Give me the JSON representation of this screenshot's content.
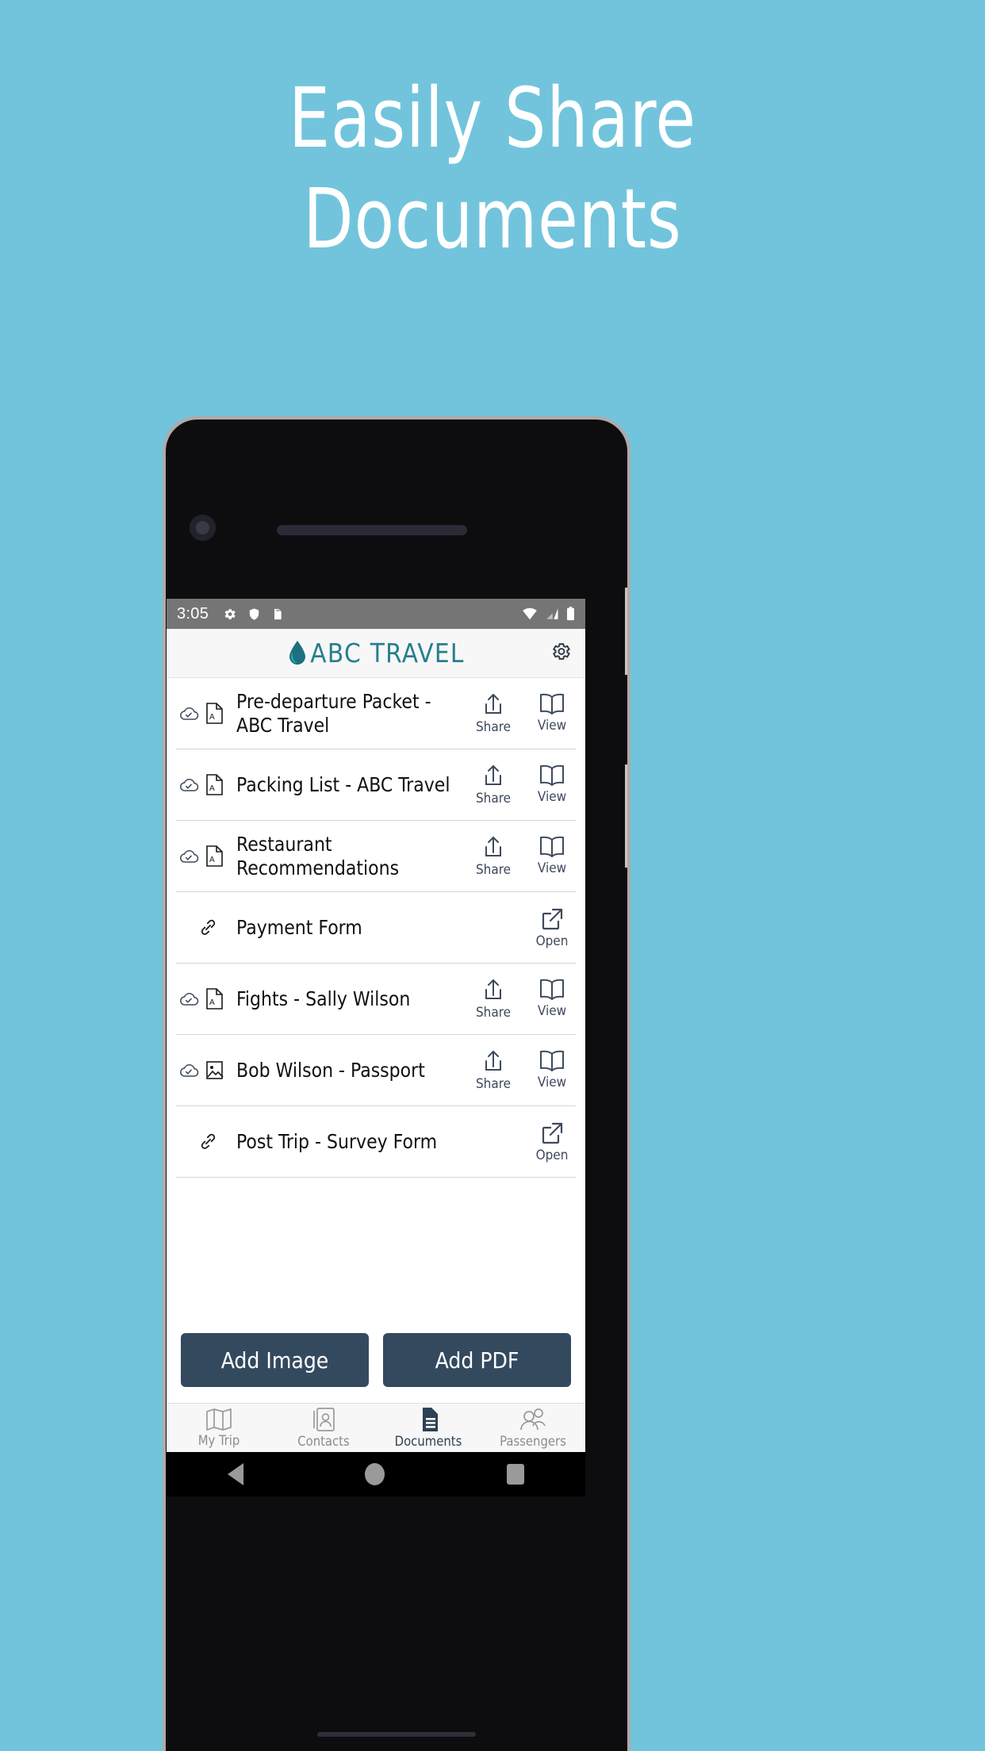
{
  "headline": {
    "line1": "Easily Share",
    "line2": "Documents"
  },
  "colors": {
    "background": "#72c4dc",
    "brand_teal": "#277f8e",
    "button_slate": "#33495e",
    "status_bar": "#757575",
    "nav_active": "#2d4154"
  },
  "statusbar": {
    "time": "3:05",
    "left_icons": [
      "gear-icon",
      "shield-icon",
      "sd-card-icon"
    ],
    "right_icons": [
      "wifi-icon",
      "cellular-signal-icon",
      "battery-icon"
    ]
  },
  "appbar": {
    "logo_icon": "water-drop-icon",
    "logo_text": "ABC TRAVEL",
    "settings_icon": "gear-icon"
  },
  "documents": [
    {
      "title": "Pre-departure Packet - ABC Travel",
      "sync_icon": "cloud-check-icon",
      "type_icon": "pdf-file-icon",
      "actions": [
        {
          "label": "Share",
          "icon": "share-upload-icon"
        },
        {
          "label": "View",
          "icon": "open-book-icon"
        }
      ]
    },
    {
      "title": "Packing List - ABC Travel",
      "sync_icon": "cloud-check-icon",
      "type_icon": "pdf-file-icon",
      "actions": [
        {
          "label": "Share",
          "icon": "share-upload-icon"
        },
        {
          "label": "View",
          "icon": "open-book-icon"
        }
      ]
    },
    {
      "title": "Restaurant Recommendations",
      "sync_icon": "cloud-check-icon",
      "type_icon": "pdf-file-icon",
      "actions": [
        {
          "label": "Share",
          "icon": "share-upload-icon"
        },
        {
          "label": "View",
          "icon": "open-book-icon"
        }
      ]
    },
    {
      "title": "Payment Form",
      "sync_icon": null,
      "type_icon": "link-chain-icon",
      "actions": [
        {
          "label": "Open",
          "icon": "external-link-icon"
        }
      ]
    },
    {
      "title": "Fights - Sally Wilson",
      "sync_icon": "cloud-check-icon",
      "type_icon": "pdf-file-icon",
      "actions": [
        {
          "label": "Share",
          "icon": "share-upload-icon"
        },
        {
          "label": "View",
          "icon": "open-book-icon"
        }
      ]
    },
    {
      "title": "Bob Wilson - Passport",
      "sync_icon": "cloud-check-icon",
      "type_icon": "image-file-icon",
      "actions": [
        {
          "label": "Share",
          "icon": "share-upload-icon"
        },
        {
          "label": "View",
          "icon": "open-book-icon"
        }
      ]
    },
    {
      "title": "Post Trip - Survey Form",
      "sync_icon": null,
      "type_icon": "link-chain-icon",
      "actions": [
        {
          "label": "Open",
          "icon": "external-link-icon"
        }
      ]
    }
  ],
  "add_buttons": [
    {
      "label": "Add Image",
      "name": "add-image-button"
    },
    {
      "label": "Add PDF",
      "name": "add-pdf-button"
    }
  ],
  "bottom_nav": [
    {
      "label": "My Trip",
      "icon": "map-icon",
      "active": false
    },
    {
      "label": "Contacts",
      "icon": "contact-card-icon",
      "active": false
    },
    {
      "label": "Documents",
      "icon": "document-icon",
      "active": true
    },
    {
      "label": "Passengers",
      "icon": "people-icon",
      "active": false
    }
  ],
  "android_nav": {
    "back": "back-triangle-icon",
    "home": "home-circle-icon",
    "recents": "recents-square-icon"
  }
}
